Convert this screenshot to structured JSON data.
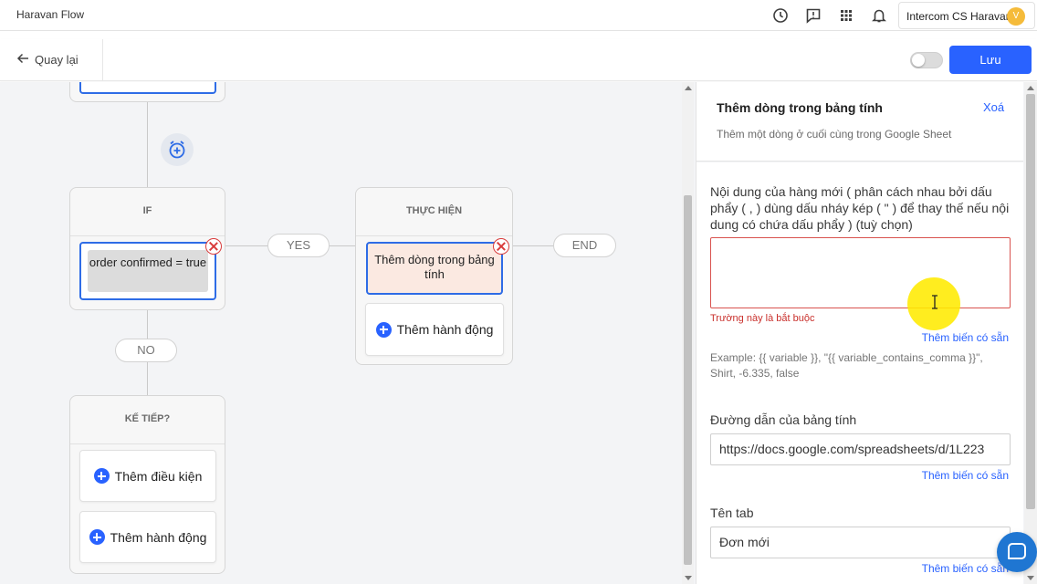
{
  "app": {
    "name": "Haravan Flow"
  },
  "header": {
    "account_name": "Intercom CS Haravan",
    "avatar_initial": "V",
    "icons": [
      "history-icon",
      "feedback-icon",
      "apps-grid-icon",
      "bell-icon"
    ]
  },
  "toolbar": {
    "back_label": "Quay lại",
    "save_label": "Lưu"
  },
  "flow": {
    "if_block": {
      "title": "IF",
      "condition": "order confirmed = true"
    },
    "yes_label": "YES",
    "no_label": "NO",
    "end_label": "END",
    "action_block": {
      "title": "THỰC HIỆN",
      "action": "Thêm dòng trong bảng tính",
      "add_action": "Thêm hành động"
    },
    "next_block": {
      "title": "KẾ TIẾP?",
      "add_condition": "Thêm điều kiện",
      "add_action": "Thêm hành động"
    }
  },
  "panel": {
    "title": "Thêm dòng trong bảng tính",
    "delete_label": "Xoá",
    "description": "Thêm một dòng ở cuối cùng trong Google Sheet",
    "row_content": {
      "label": "Nội dung của hàng mới ( phân cách nhau bởi dấu phẩy ( , ) dùng dấu nháy kép ( \" ) để thay thế nếu nội dung có chứa dấu phẩy ) (tuỳ chọn)",
      "value": "",
      "error": "Trường này là bắt buộc",
      "var_link": "Thêm biến có sẵn",
      "example": "Example: {{ variable }}, \"{{ variable_contains_comma }}\", Shirt, -6.335, false"
    },
    "sheet_url": {
      "label": "Đường dẫn của bảng tính",
      "value": "https://docs.google.com/spreadsheets/d/1L223",
      "var_link": "Thêm biến có sẵn"
    },
    "tab_name": {
      "label": "Tên tab",
      "value": "Đơn mới",
      "var_link": "Thêm biến có sẵn"
    }
  },
  "colors": {
    "primary": "#2962ff",
    "error": "#d9534f",
    "action_bg": "#fbe9e1"
  }
}
